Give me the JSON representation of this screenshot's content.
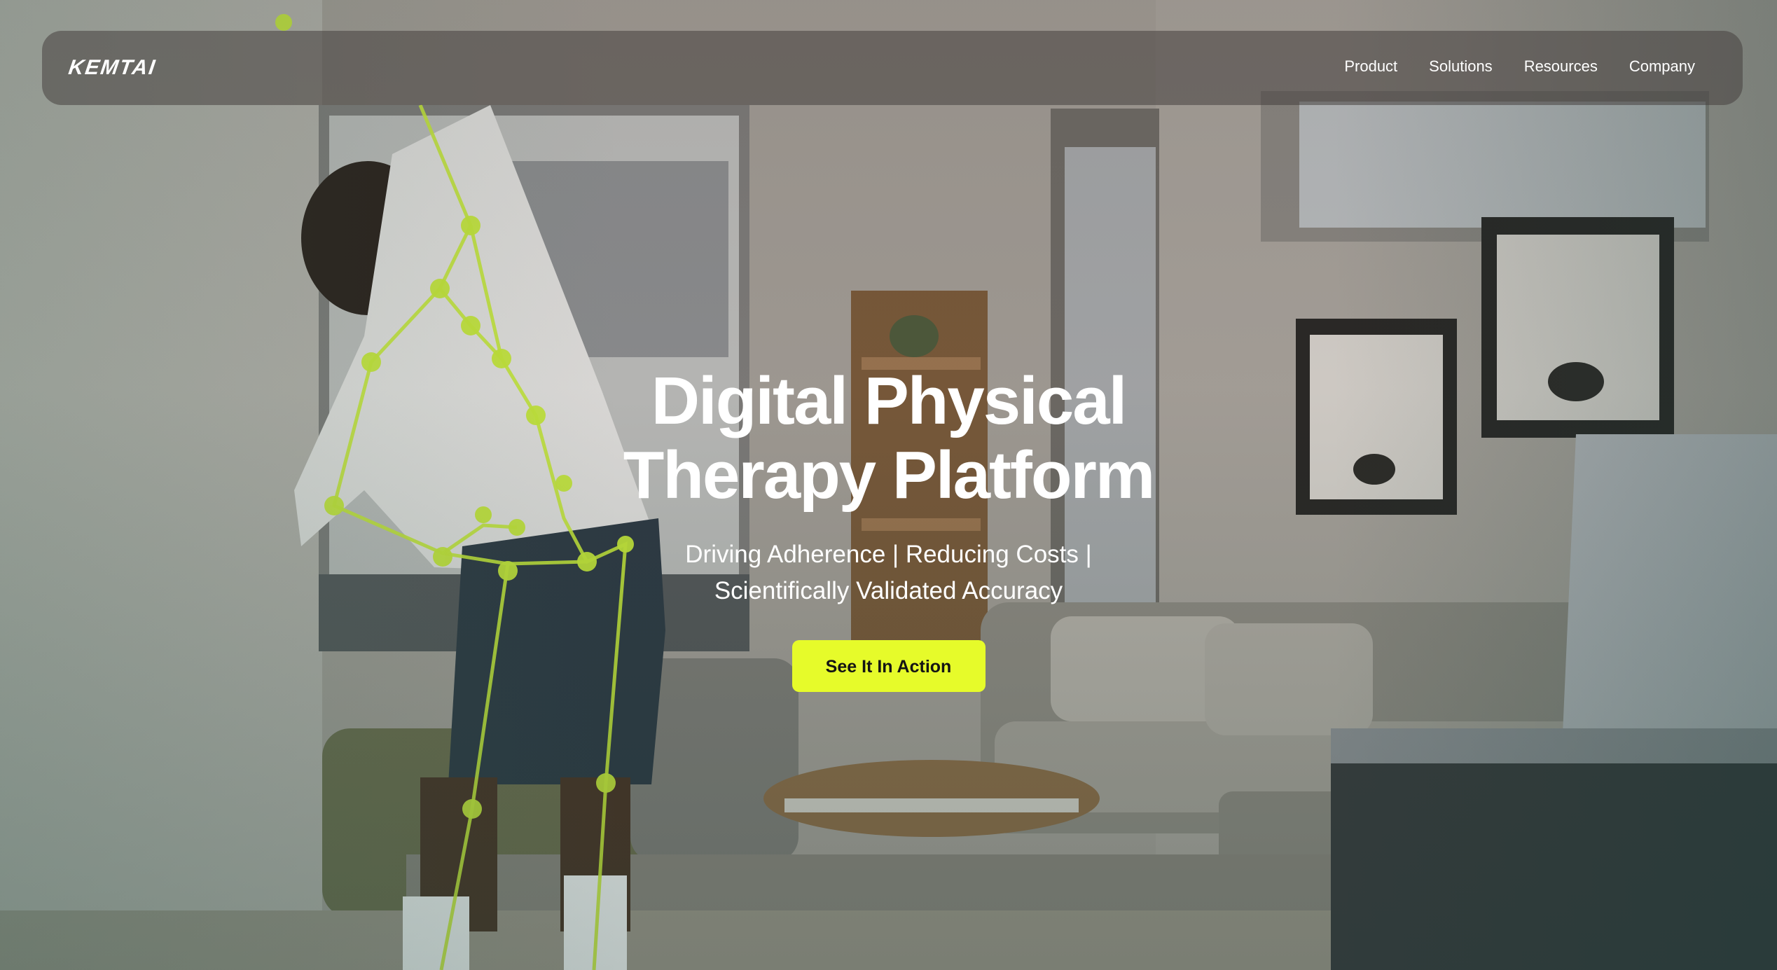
{
  "brand": {
    "logo_text": "KEMTAI"
  },
  "nav": {
    "items": [
      {
        "label": "Product"
      },
      {
        "label": "Solutions"
      },
      {
        "label": "Resources"
      },
      {
        "label": "Company"
      }
    ]
  },
  "hero": {
    "title_line1": "Digital Physical",
    "title_line2": "Therapy Platform",
    "subtitle_line1": "Driving Adherence | Reducing Costs |",
    "subtitle_line2": "Scientifically Validated Accuracy",
    "cta_label": "See It In Action"
  },
  "colors": {
    "accent": "#e6fb2a",
    "skeleton": "#c6e83a",
    "text": "#ffffff"
  }
}
